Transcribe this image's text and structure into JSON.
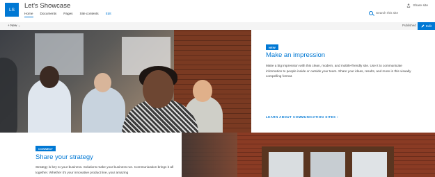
{
  "header": {
    "logo_initials": "LS",
    "site_title": "Let's Showcase",
    "nav": [
      {
        "label": "Home",
        "active": true
      },
      {
        "label": "Documents"
      },
      {
        "label": "Pages"
      },
      {
        "label": "Site contents"
      },
      {
        "label": "Edit",
        "edit": true
      }
    ],
    "share_label": "Share site",
    "search_placeholder": "Search this site"
  },
  "command_bar": {
    "new_label": "+ New ⌄",
    "status": "Published",
    "edit_label": "Edit"
  },
  "hero": {
    "tag": "NEW",
    "title": "Make an impression",
    "body": "Make a big impression with this clean, modern, and mobile-friendly site. Use it to communicate information to people inside or outside your team. Share your ideas, results, and more in this visually compelling format.",
    "link": "LEARN ABOUT COMMUNICATION SITES  ›"
  },
  "strategy": {
    "tag": "CONNECT",
    "title": "Share your strategy",
    "body": "Strategy is key to your business. Solutions make your business run. Communication brings it all together. Whether it's your innovative product line, your amazing"
  },
  "colors": {
    "accent": "#0078d4",
    "command_bar": "#f4f4f4"
  }
}
